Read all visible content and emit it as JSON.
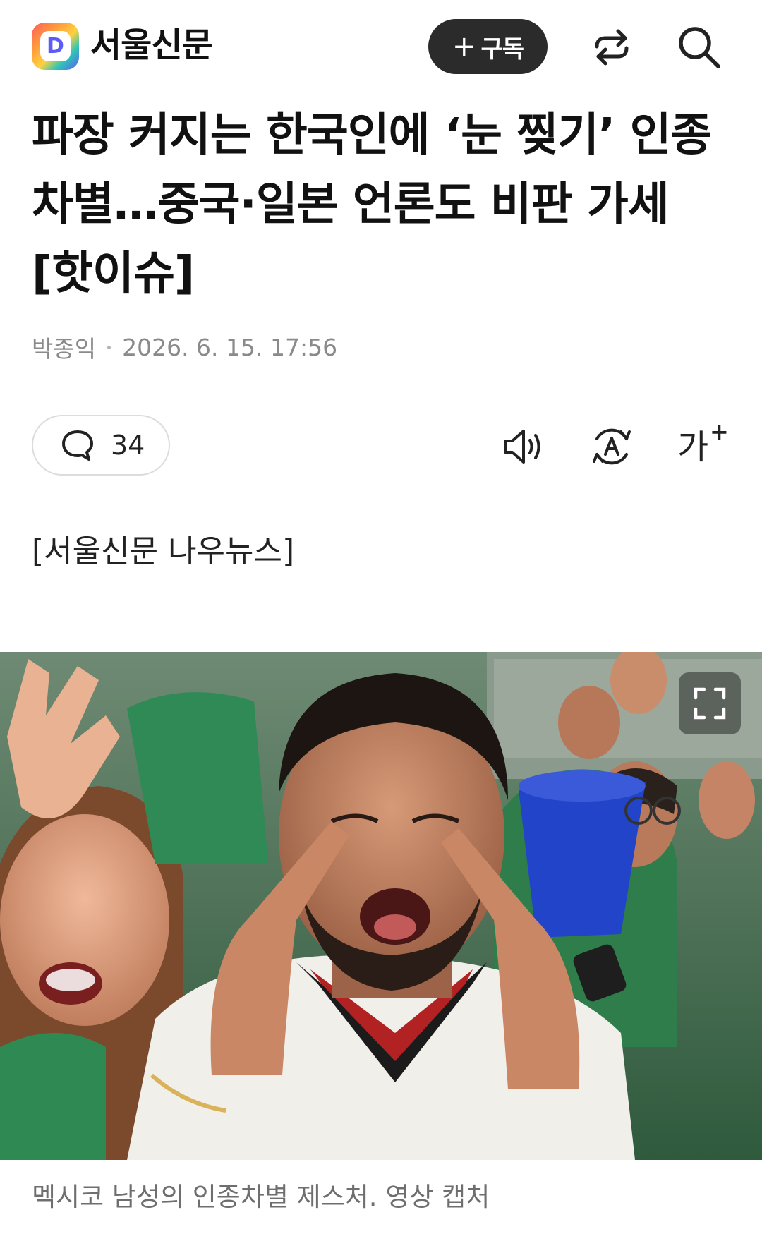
{
  "header": {
    "logo_letter": "D",
    "brand": "서울신문",
    "subscribe_label": "구독"
  },
  "article": {
    "headline": "파장 커지는 한국인에 ‘눈 찢기’ 인종차별…중국·일본 언론도 비판 가세 [핫이슈]",
    "author": "박종익",
    "datetime": "2026. 6. 15. 17:56",
    "comment_count": "34",
    "font_size_label": "가",
    "font_size_sup": "+",
    "source_tag": "[서울신문 나우뉴스]",
    "photo_caption": "멕시코 남성의 인종차별 제스처. 영상 캡처"
  },
  "icons": {
    "share": "share-icon",
    "search": "search-icon",
    "comment": "comment-icon",
    "speaker": "speaker-icon",
    "translate": "translate-icon",
    "expand": "expand-icon"
  },
  "colors": {
    "subscribe_bg": "#2b2b2b",
    "meta_text": "#8a8a8a",
    "caption_text": "#6e6e6e"
  }
}
